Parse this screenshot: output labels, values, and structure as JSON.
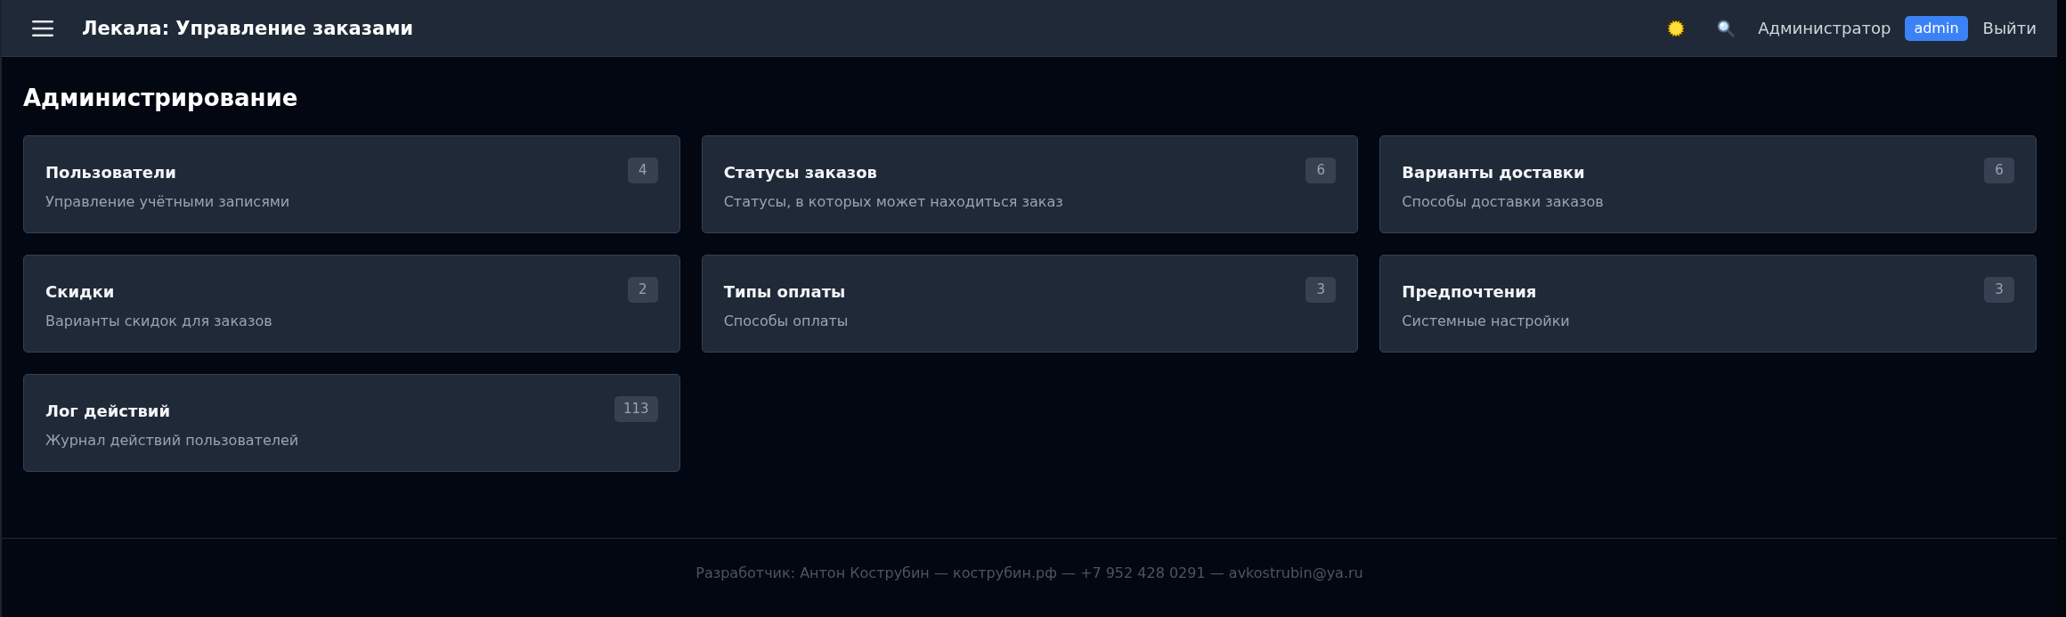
{
  "header": {
    "title": "Лекала: Управление заказами",
    "user_name": "Администратор",
    "role_badge": "admin",
    "logout": "Выйти"
  },
  "page": {
    "heading": "Администрирование"
  },
  "cards": [
    {
      "title": "Пользователи",
      "description": "Управление учётными записями",
      "count": "4"
    },
    {
      "title": "Статусы заказов",
      "description": "Статусы, в которых может находиться заказ",
      "count": "6"
    },
    {
      "title": "Варианты доставки",
      "description": "Способы доставки заказов",
      "count": "6"
    },
    {
      "title": "Скидки",
      "description": "Варианты скидок для заказов",
      "count": "2"
    },
    {
      "title": "Типы оплаты",
      "description": "Способы оплаты",
      "count": "3"
    },
    {
      "title": "Предпочтения",
      "description": "Системные настройки",
      "count": "3"
    },
    {
      "title": "Лог действий",
      "description": "Журнал действий пользователей",
      "count": "113"
    }
  ],
  "footer": {
    "text": "Разработчик: Антон Кострубин — кострубин.рф — +7 952 428 0291 — avkostrubin@ya.ru"
  }
}
